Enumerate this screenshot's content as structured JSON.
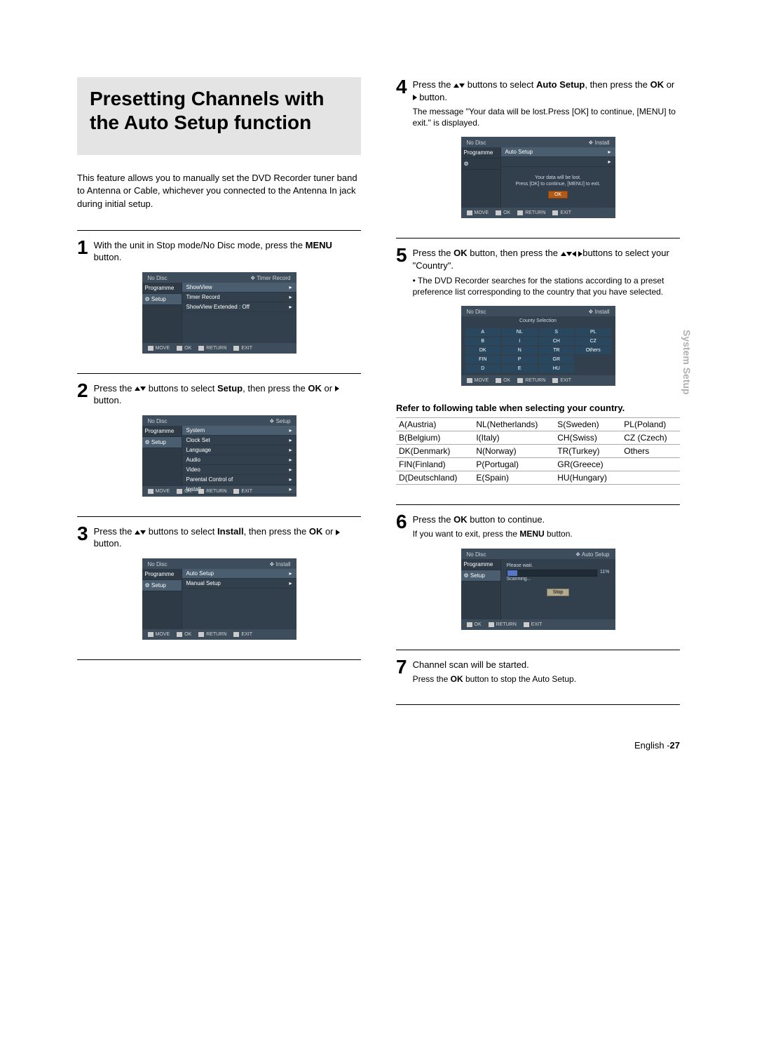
{
  "title": "Presetting Channels with the Auto Setup function",
  "intro": "This feature allows you to manually set the DVD Recorder tuner band to Antenna or Cable, whichever you connected to the Antenna In jack during initial setup.",
  "side_tab": "System Setup",
  "footer_lang": "English -",
  "footer_page": "27",
  "steps": {
    "s1": {
      "num": "1",
      "text_a": "With the unit in Stop mode/No Disc mode, press the ",
      "text_b": "MENU",
      "text_c": " button."
    },
    "s2": {
      "num": "2",
      "text_a": "Press the ",
      "text_b": " buttons to select ",
      "text_c": "Setup",
      "text_d": ", then press the ",
      "text_e": "OK",
      "text_f": " or ",
      "text_g": " button."
    },
    "s3": {
      "num": "3",
      "text_a": "Press the ",
      "text_b": " buttons to select ",
      "text_c": "Install",
      "text_d": ", then press the ",
      "text_e": "OK",
      "text_f": " or ",
      "text_g": " button."
    },
    "s4": {
      "num": "4",
      "text_a": "Press the ",
      "text_b": " buttons to select ",
      "text_c": "Auto Setup",
      "text_d": ", then press the ",
      "text_e": "OK",
      "text_f": " or ",
      "text_g": " button.",
      "sub": "The message \"Your data will be lost.Press [OK] to continue, [MENU] to exit.\" is displayed."
    },
    "s5": {
      "num": "5",
      "text_a": "Press the ",
      "text_b": "OK",
      "text_c": " button, then press the ",
      "text_d": "buttons to select your \"Country\".",
      "sub": "• The DVD Recorder searches for the stations according to a preset preference list corresponding to the country that you have selected."
    },
    "s6": {
      "num": "6",
      "text_a": "Press the ",
      "text_b": "OK",
      "text_c": " button to continue.",
      "sub_a": "If you want to exit, press the ",
      "sub_b": "MENU",
      "sub_c": " button."
    },
    "s7": {
      "num": "7",
      "text_a": "Channel scan will be started.",
      "sub_a": "Press the ",
      "sub_b": "OK",
      "sub_c": " button to stop the Auto Setup."
    }
  },
  "table_note": "Refer to following table when selecting your country.",
  "country_table": [
    [
      "A(Austria)",
      "NL(Netherlands)",
      "S(Sweden)",
      "PL(Poland)"
    ],
    [
      "B(Belgium)",
      "I(Italy)",
      "CH(Swiss)",
      "CZ (Czech)"
    ],
    [
      "DK(Denmark)",
      "N(Norway)",
      "TR(Turkey)",
      "Others"
    ],
    [
      "FIN(Finland)",
      "P(Portugal)",
      "GR(Greece)",
      ""
    ],
    [
      "D(Deutschland)",
      "E(Spain)",
      "HU(Hungary)",
      ""
    ]
  ],
  "osd": {
    "no_disc": "No Disc",
    "programme": "Programme",
    "setup": "Setup",
    "foot_move": "MOVE",
    "foot_ok": "OK",
    "foot_return": "RETURN",
    "foot_exit": "EXIT",
    "screen1": {
      "crumb": "Timer Record",
      "items": [
        "ShowView",
        "Timer Record",
        "ShowView Extended : Off"
      ]
    },
    "screen2": {
      "crumb": "Setup",
      "items": [
        "System",
        "Clock Set",
        "Language",
        "Audio",
        "Video",
        "Parental Control of",
        "Install"
      ]
    },
    "screen3": {
      "crumb": "Install",
      "items": [
        "Auto Setup",
        "Manual Setup"
      ]
    },
    "screen4": {
      "crumb": "Install",
      "row_hi": "Auto Setup",
      "line1": "Your data will be lost.",
      "line2": "Press [OK] to continue, [MENU] to exit.",
      "ok": "OK"
    },
    "screen5": {
      "crumb": "Install",
      "subtitle": "County Selection",
      "grid": [
        "A",
        "NL",
        "S",
        "PL",
        "B",
        "I",
        "CH",
        "CZ",
        "DK",
        "N",
        "TR",
        "Others",
        "FIN",
        "P",
        "GR",
        "",
        "D",
        "E",
        "HU",
        ""
      ]
    },
    "screen6": {
      "crumb": "Auto Setup",
      "please": "Please wait.",
      "percent": "11%",
      "scanning": "Scanning...",
      "stop": "Stop"
    }
  }
}
